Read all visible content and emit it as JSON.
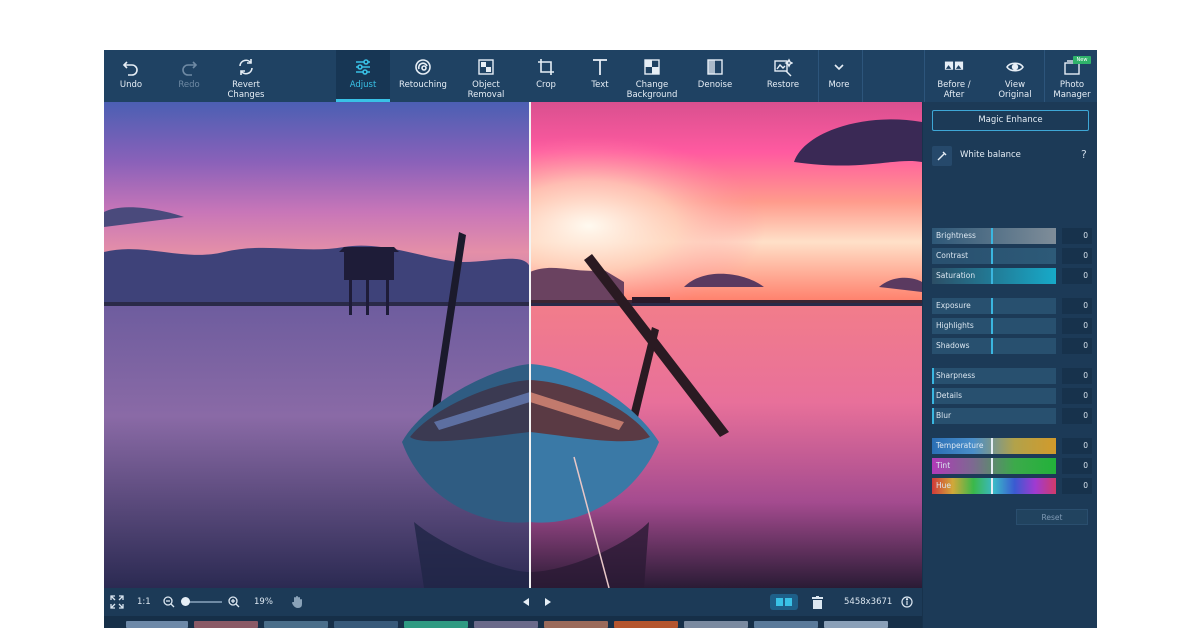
{
  "toolbar": {
    "undo": "Undo",
    "redo": "Redo",
    "revert": "Revert Changes",
    "adjust": "Adjust",
    "retouching": "Retouching",
    "object_removal": "Object Removal",
    "crop": "Crop",
    "text": "Text",
    "change_background": "Change Background",
    "denoise": "Denoise",
    "restore": "Restore",
    "more": "More",
    "before_after": "Before / After",
    "view_original": "View Original",
    "photo_manager": "Photo Manager",
    "new_badge": "New"
  },
  "panel": {
    "magic_enhance": "Magic Enhance",
    "white_balance": "White balance",
    "help": "?",
    "sliders": [
      {
        "name": "Brightness",
        "value": "0"
      },
      {
        "name": "Contrast",
        "value": "0"
      },
      {
        "name": "Saturation",
        "value": "0"
      },
      {
        "name": "Exposure",
        "value": "0"
      },
      {
        "name": "Highlights",
        "value": "0"
      },
      {
        "name": "Shadows",
        "value": "0"
      },
      {
        "name": "Sharpness",
        "value": "0"
      },
      {
        "name": "Details",
        "value": "0"
      },
      {
        "name": "Blur",
        "value": "0"
      },
      {
        "name": "Temperature",
        "value": "0"
      },
      {
        "name": "Tint",
        "value": "0"
      },
      {
        "name": "Hue",
        "value": "0"
      }
    ],
    "reset": "Reset"
  },
  "bottom": {
    "one_to_one": "1:1",
    "zoom": "19%",
    "dimensions": "5458x3671"
  },
  "colors": {
    "accent": "#39c1e6",
    "toolbar_bg": "#1f4263",
    "panel_bg": "#1c3a57"
  }
}
